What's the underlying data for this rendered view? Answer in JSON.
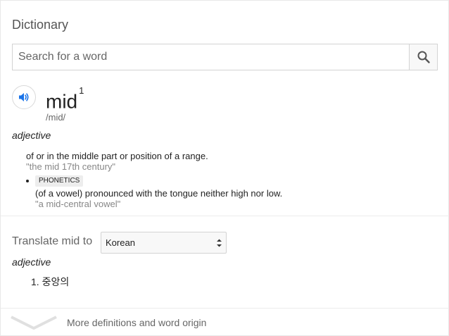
{
  "panel": {
    "title": "Dictionary"
  },
  "search": {
    "placeholder": "Search for a word"
  },
  "entry": {
    "word": "mid",
    "superscript": "1",
    "phonetic": "/mid/",
    "part_of_speech": "adjective",
    "senses": [
      {
        "definition": "of or in the middle part or position of a range.",
        "example": "\"the mid 17th century\""
      },
      {
        "tag": "PHONETICS",
        "definition": "(of a vowel) pronounced with the tongue neither high nor low.",
        "example": "\"a mid-central vowel\""
      }
    ]
  },
  "translate": {
    "label": "Translate mid to",
    "selected_language": "Korean",
    "part_of_speech": "adjective",
    "items": [
      "1. 중앙의"
    ]
  },
  "footer": {
    "more_label": "More definitions and word origin"
  },
  "icons": {
    "search": "search-icon",
    "audio": "speaker-icon",
    "select": "select-arrows-icon",
    "more": "chevron-down-icon"
  },
  "colors": {
    "accent": "#1a73e8",
    "muted_text": "#666666",
    "example_text": "#878787"
  }
}
